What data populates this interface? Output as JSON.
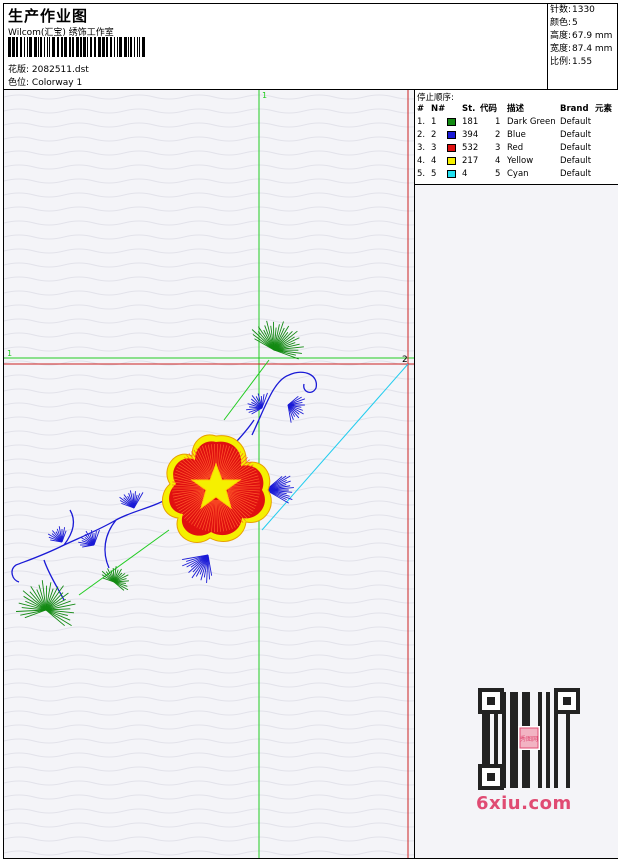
{
  "header": {
    "title": "生产作业图",
    "company": "Wilcom(汇宝) 绣饰工作室",
    "design_label": "花版:",
    "design_file": "2082511.dst",
    "colorway_label": "色位:",
    "colorway": "Colorway 1"
  },
  "stats": {
    "stitches_label": "针数:",
    "stitches": "1330",
    "colors_label": "颜色:",
    "colors": "5",
    "height_label": "高度:",
    "height": "67.9 mm",
    "width_label": "宽度:",
    "width": "87.4 mm",
    "scale_label": "比例:",
    "scale": "1.55"
  },
  "stop_sequence": {
    "title": "停止顺序:",
    "headers": [
      "#",
      "N#",
      "St.",
      "代码",
      "描述",
      "Brand",
      "元素"
    ],
    "rows": [
      {
        "num": "1.",
        "n": "1",
        "stitches": "181",
        "code": "1",
        "description": "Dark Green",
        "brand": "Default",
        "color": "#138a13"
      },
      {
        "num": "2.",
        "n": "2",
        "stitches": "394",
        "code": "2",
        "description": "Blue",
        "brand": "Default",
        "color": "#1a1ad6"
      },
      {
        "num": "3.",
        "n": "3",
        "stitches": "532",
        "code": "3",
        "description": "Red",
        "brand": "Default",
        "color": "#e01010"
      },
      {
        "num": "4.",
        "n": "4",
        "stitches": "217",
        "code": "4",
        "description": "Yellow",
        "brand": "Default",
        "color": "#f5f000"
      },
      {
        "num": "5.",
        "n": "5",
        "stitches": "4",
        "code": "5",
        "description": "Cyan",
        "brand": "Default",
        "color": "#22e0f0"
      }
    ]
  },
  "canvas": {
    "marker_v1": "1",
    "marker_h1": "1",
    "marker_h2": "2",
    "marker_bottom": "2",
    "guide_green": "#22cc22",
    "guide_red": "#cc2222",
    "guide_cyan": "#22ccee"
  },
  "watermark": {
    "text": "6xiu.com",
    "qr_stamp": "秀图网"
  }
}
